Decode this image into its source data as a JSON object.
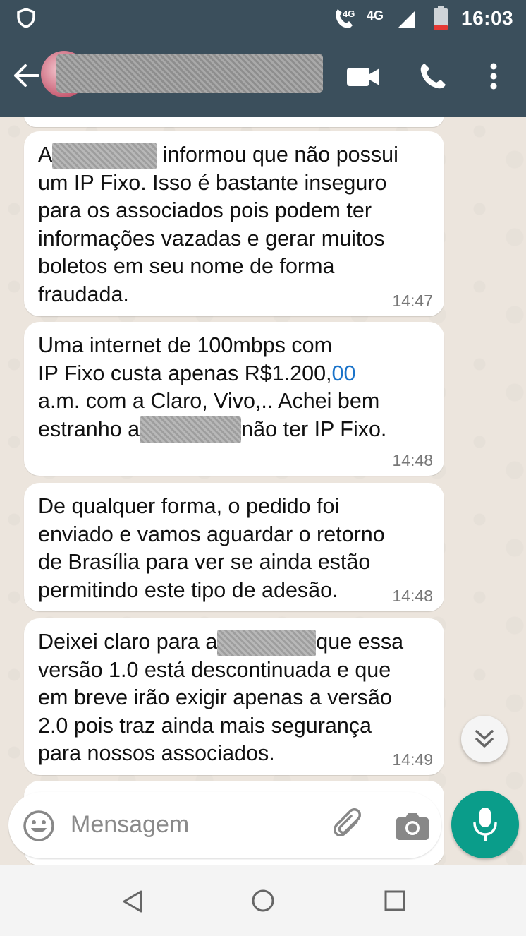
{
  "status_bar": {
    "time": "16:03",
    "network_labels": [
      "4G",
      "4G"
    ]
  },
  "app_bar": {
    "icons": [
      "back-arrow-icon",
      "video-call-icon",
      "phone-icon",
      "more-options-icon"
    ]
  },
  "messages": [
    {
      "parts": [
        "A",
        "[redacted]",
        "informou que não possui um IP Fixo. Isso é bastante inseguro para os associados pois podem ter informações vazadas e gerar muitos boletos em seu nome de forma fraudada."
      ],
      "line1_pre": "A",
      "line1_post": "informou que não possui",
      "rest": "um IP Fixo. Isso é bastante inseguro\npara os associados pois podem ter\ninformações vazadas e gerar muitos\nboletos em seu nome de forma\nfraudada.",
      "time": "14:47"
    },
    {
      "line1": "Uma internet de 100mbps com",
      "line2_pre": "IP Fixo custa apenas R$1.200,",
      "line2_link": "00",
      "line3": "a.m. com a Claro, Vivo,.. Achei bem",
      "line4_pre": "estranho a",
      "line4_post": "não ter IP Fixo.",
      "time": "14:48"
    },
    {
      "text": "De qualquer forma, o pedido foi\nenviado e vamos aguardar o retorno\nde Brasília para ver se ainda estão\npermitindo este tipo de adesão.",
      "time": "14:48"
    },
    {
      "line1_pre": "Deixei claro para a",
      "line1_post": "que essa",
      "rest": "versão 1.0 está descontinuada e que\nem breve irão exigir apenas a versão\n2.0 pois traz ainda mais segurança\npara nossos associados.",
      "time": "14:49"
    }
  ],
  "input": {
    "placeholder": "Mensagem",
    "icons": [
      "emoji-icon",
      "attach-icon",
      "camera-icon",
      "mic-icon"
    ]
  },
  "colors": {
    "header": "#3b4f5c",
    "chat_background": "#ece5dd",
    "mic_button": "#0a9d8a",
    "link": "#1a73c9"
  }
}
